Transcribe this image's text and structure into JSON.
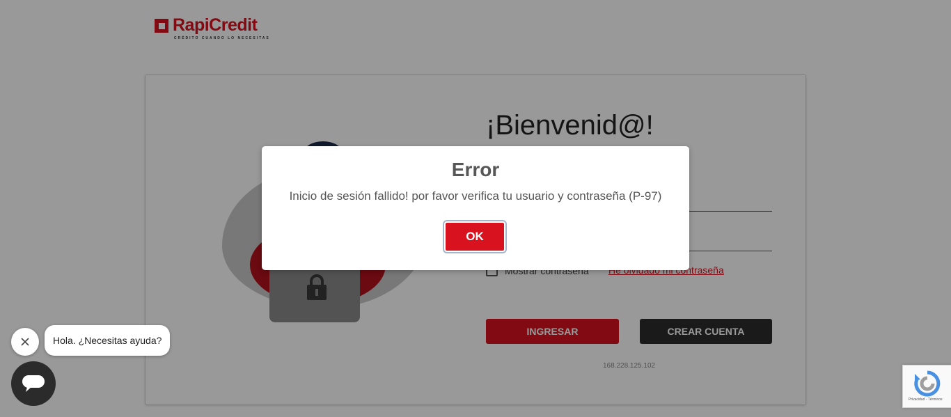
{
  "logo": {
    "brand": "RapiCredit",
    "tagline": "CRÉDITO CUANDO LO NECESITAS"
  },
  "form": {
    "welcome": "¡Bienvenid@!",
    "show_password_label": "Mostrar contraseña",
    "forgot_password_link": "He olvidado mi contraseña",
    "login_button": "INGRESAR",
    "create_account_button": "CREAR CUENTA",
    "ip_address": "168.228.125.102"
  },
  "modal": {
    "title": "Error",
    "message": "Inicio de sesión fallido! por favor verifica tu usuario y contraseña (P-97)",
    "ok_button": "OK"
  },
  "chat": {
    "greeting": "Hola. ¿Necesitas ayuda?"
  },
  "recaptcha": {
    "terms": "Privacidad - Términos"
  },
  "colors": {
    "brand_red": "#d9121f",
    "dark_button": "#2c2c2c",
    "overlay": "rgba(0,0,0,0.4)"
  }
}
